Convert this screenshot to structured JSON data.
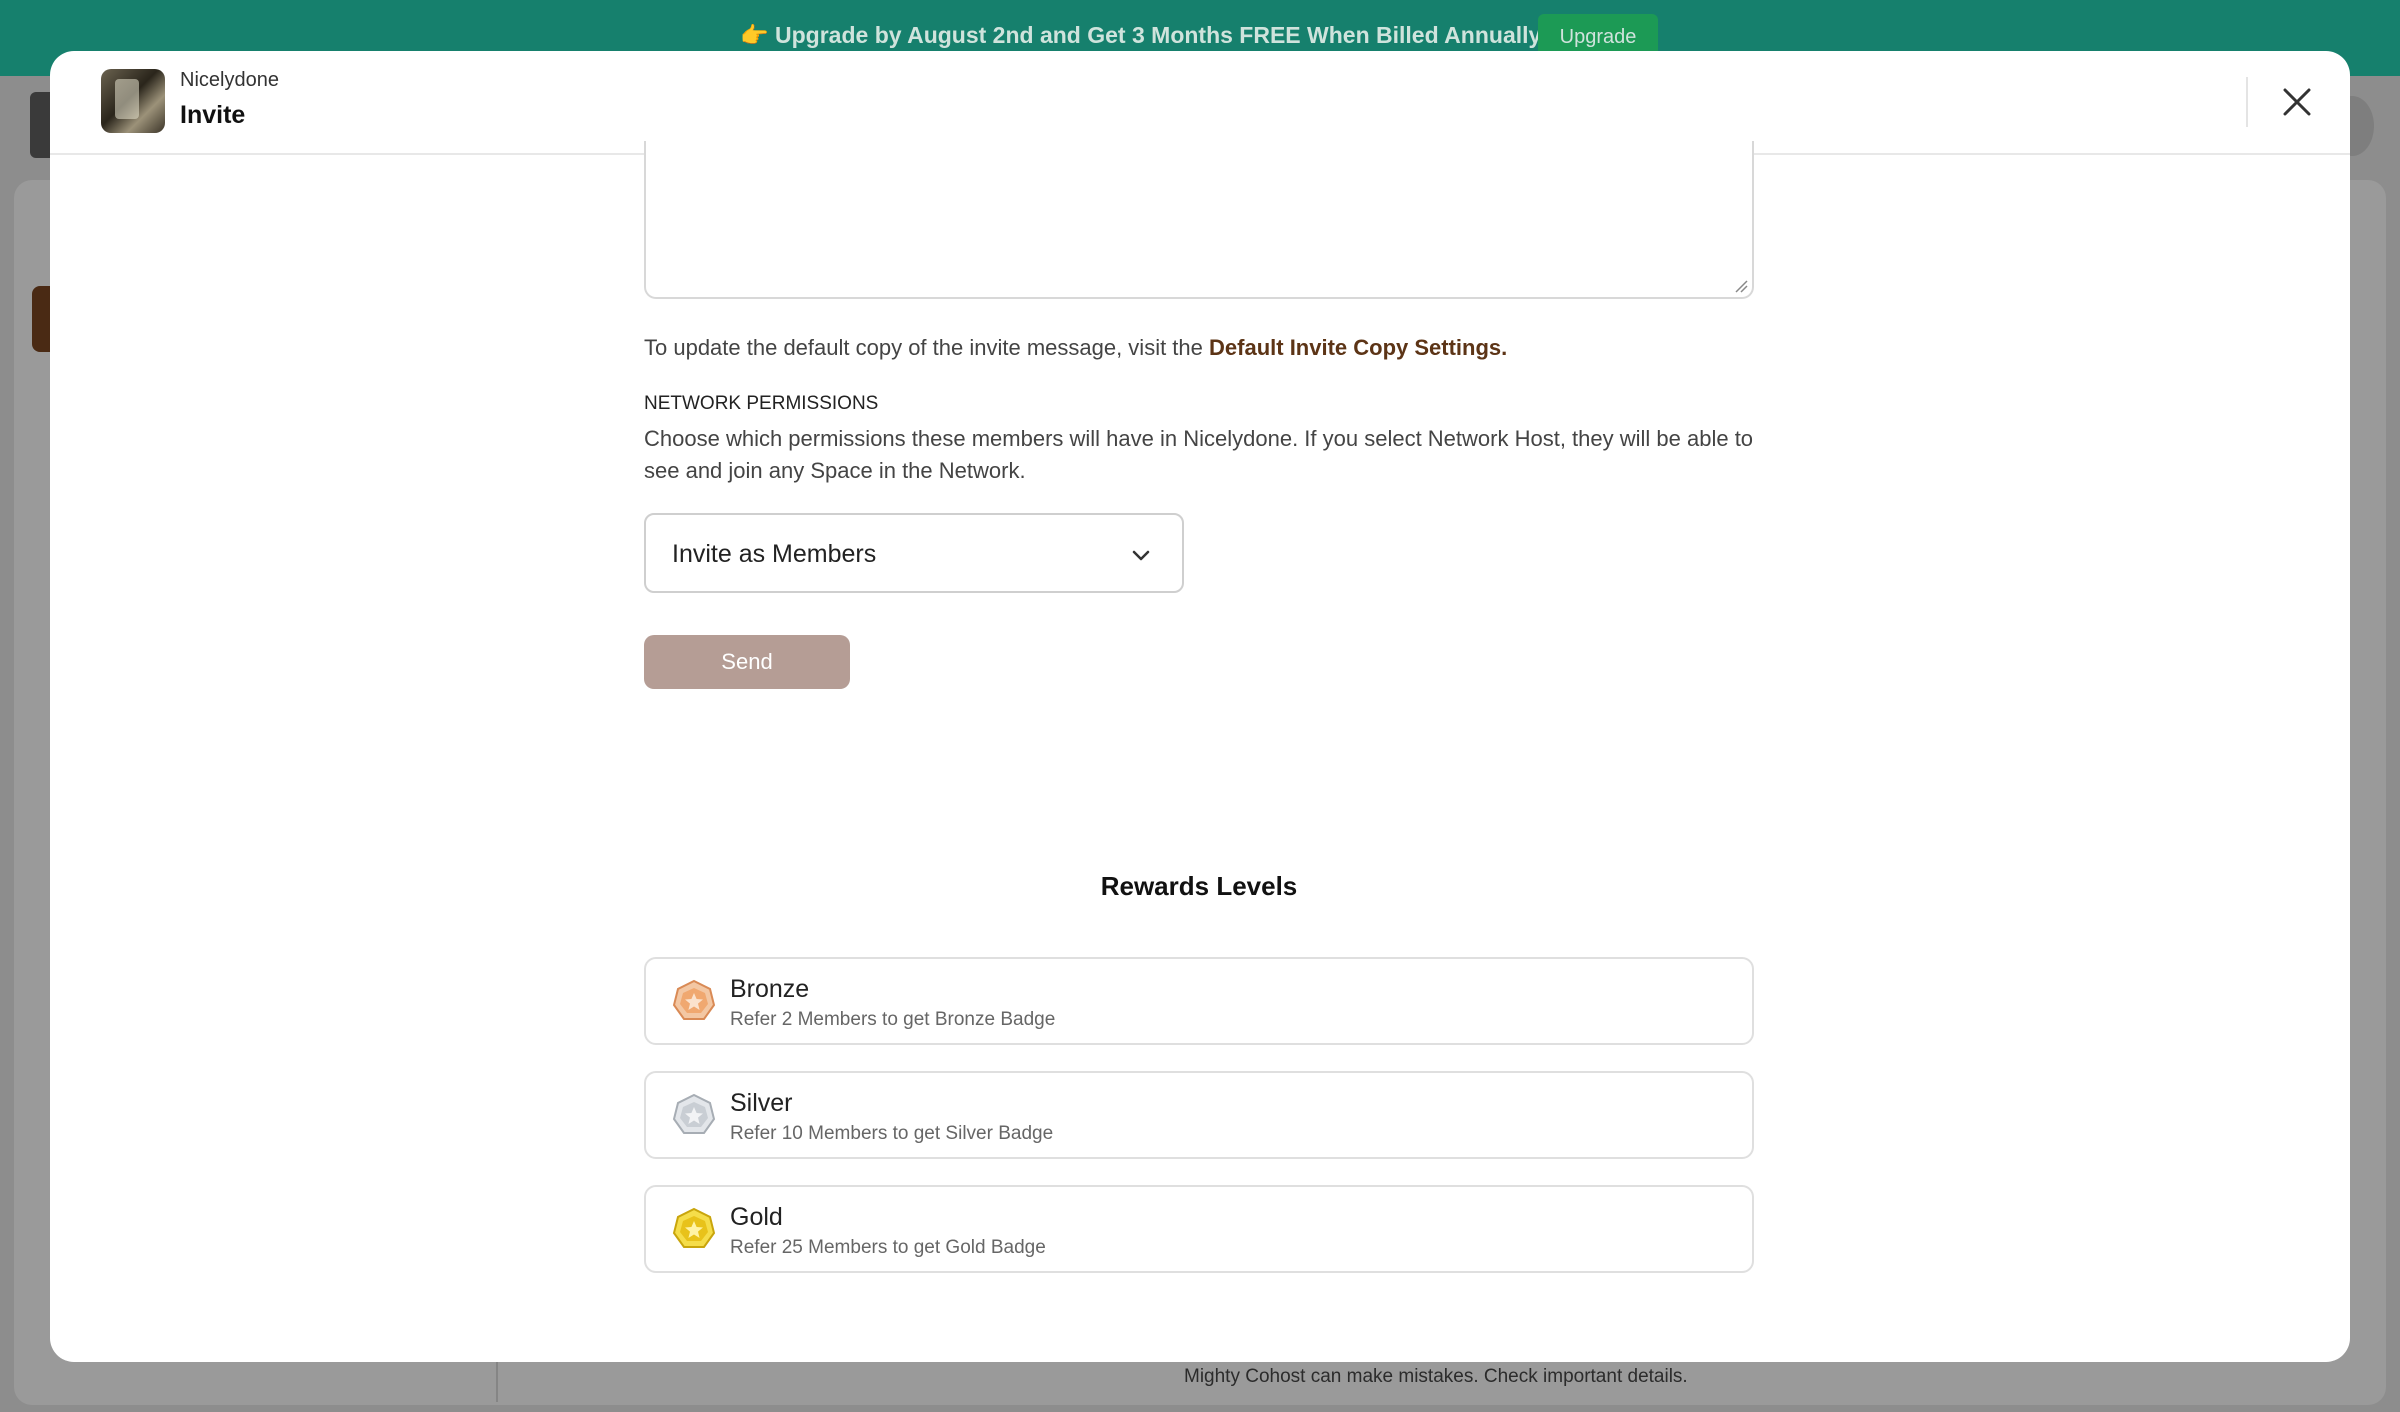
{
  "banner": {
    "text": "👉 Upgrade by August 2nd and Get 3 Months FREE When Billed Annually",
    "button_label": "Upgrade"
  },
  "background": {
    "footer_text": "Mighty Cohost can make mistakes. Check important details."
  },
  "modal": {
    "org_name": "Nicelydone",
    "title": "Invite",
    "hint_prefix": "To update the default copy of the invite message, visit the ",
    "hint_link": "Default Invite Copy Settings.",
    "permissions_title": "NETWORK PERMISSIONS",
    "permissions_desc": "Choose which permissions these members will have in Nicelydone. If you select Network Host, they will be able to see and join any Space in the Network.",
    "permission_select_value": "Invite as Members",
    "send_label": "Send",
    "rewards_title": "Rewards Levels",
    "rewards": [
      {
        "name": "Bronze",
        "desc": "Refer 2 Members to get Bronze Badge",
        "icon": "bronze-badge-icon",
        "color": "#e8a06a"
      },
      {
        "name": "Silver",
        "desc": "Refer 10 Members to get Silver Badge",
        "icon": "silver-badge-icon",
        "color": "#b9bec4"
      },
      {
        "name": "Gold",
        "desc": "Refer 25 Members to get Gold Badge",
        "icon": "gold-badge-icon",
        "color": "#e8c21a"
      }
    ]
  },
  "colors": {
    "banner_bg": "#16806d",
    "link": "#5c3416",
    "send_button": "#b59d95"
  }
}
